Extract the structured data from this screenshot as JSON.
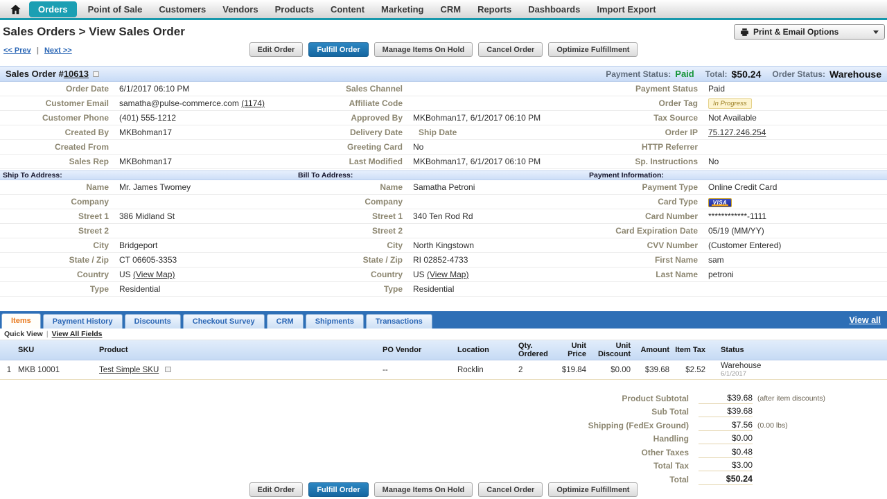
{
  "nav": {
    "items": [
      "Orders",
      "Point of Sale",
      "Customers",
      "Vendors",
      "Products",
      "Content",
      "Marketing",
      "CRM",
      "Reports",
      "Dashboards",
      "Import Export"
    ]
  },
  "header": {
    "title": "Sales Orders > View Sales Order",
    "print_email": "Print & Email Options"
  },
  "pager": {
    "prev": "<< Prev",
    "sep": "|",
    "next": "Next >>"
  },
  "buttons": {
    "edit": "Edit Order",
    "fulfill": "Fulfill Order",
    "manage_hold": "Manage Items On Hold",
    "cancel": "Cancel Order",
    "optimize": "Optimize Fulfillment"
  },
  "order_bar": {
    "title": "Sales Order #",
    "number": "10613",
    "payment_status_label": "Payment Status:",
    "payment_status": "Paid",
    "total_label": "Total:",
    "total": "$50.24",
    "order_status_label": "Order Status:",
    "order_status": "Warehouse"
  },
  "details": {
    "rows": [
      {
        "c1l": "Order Date",
        "c1v": "6/1/2017 06:10 PM",
        "c2l": "Sales Channel",
        "c2v": "",
        "c3l": "Payment Status",
        "c3v": "Paid"
      },
      {
        "c1l": "Customer Email",
        "c1v": "samatha@pulse-commerce.com",
        "c1link": "(1174)",
        "c2l": "Affiliate Code",
        "c2v": "",
        "c3l": "Order Tag",
        "c3badge": "In Progress"
      },
      {
        "c1l": "Customer Phone",
        "c1v": "(401) 555-1212",
        "c2l": "Approved By",
        "c2v": "MKBohman17, 6/1/2017 06:10 PM",
        "c3l": "Tax Source",
        "c3v": "Not Available"
      },
      {
        "c1l": "Created By",
        "c1v": "MKBohman17",
        "c2l": "Delivery Date",
        "c2sublabel": "Ship Date",
        "c3l": "Order IP",
        "c3link": "75.127.246.254"
      },
      {
        "c1l": "Created From",
        "c1v": "",
        "c2l": "Greeting Card",
        "c2v": "No",
        "c3l": "HTTP Referrer",
        "c3v": ""
      },
      {
        "c1l": "Sales Rep",
        "c1v": "MKBohman17",
        "c2l": "Last Modified",
        "c2v": "MKBohman17, 6/1/2017 06:10 PM",
        "c3l": "Sp. Instructions",
        "c3v": "No"
      }
    ]
  },
  "sections": {
    "ship_to": "Ship To Address:",
    "bill_to": "Bill To Address:",
    "payment_info": "Payment Information:"
  },
  "address": {
    "rows": [
      {
        "c1l": "Name",
        "c1v": "Mr. James Twomey",
        "c2l": "Name",
        "c2v": "Samatha Petroni",
        "c3l": "Payment Type",
        "c3v": "Online Credit Card"
      },
      {
        "c1l": "Company",
        "c1v": "",
        "c2l": "Company",
        "c2v": "",
        "c3l": "Card Type",
        "c3visa": "VISA"
      },
      {
        "c1l": "Street 1",
        "c1v": "386 Midland St",
        "c2l": "Street 1",
        "c2v": "340 Ten Rod Rd",
        "c3l": "Card Number",
        "c3v": "************-1111"
      },
      {
        "c1l": "Street 2",
        "c1v": "",
        "c2l": "Street 2",
        "c2v": "",
        "c3l": "Card Expiration Date",
        "c3v": "05/19 (MM/YY)"
      },
      {
        "c1l": "City",
        "c1v": "Bridgeport",
        "c2l": "City",
        "c2v": "North Kingstown",
        "c3l": "CVV Number",
        "c3v": "(Customer Entered)"
      },
      {
        "c1l": "State / Zip",
        "c1v": "CT 06605-3353",
        "c2l": "State / Zip",
        "c2v": "RI 02852-4733",
        "c3l": "First Name",
        "c3v": "sam"
      },
      {
        "c1l": "Country",
        "c1v": "US",
        "c1link": "(View Map)",
        "c2l": "Country",
        "c2v": "US",
        "c2link": "(View Map)",
        "c3l": "Last Name",
        "c3v": "petroni"
      },
      {
        "c1l": "Type",
        "c1v": "Residential",
        "c2l": "Type",
        "c2v": "Residential",
        "c3l": "",
        "c3v": ""
      }
    ]
  },
  "tabs": {
    "items": "Items",
    "payment_history": "Payment History",
    "discounts": "Discounts",
    "checkout_survey": "Checkout Survey",
    "crm": "CRM",
    "shipments": "Shipments",
    "transactions": "Transactions",
    "view_all": "View all"
  },
  "quickview": {
    "quick_view": "Quick View",
    "sep": "|",
    "view_all_fields": "View All Fields"
  },
  "items_table": {
    "headers": {
      "sku": "SKU",
      "product": "Product",
      "po_vendor": "PO Vendor",
      "location": "Location",
      "qty": "Qty. Ordered",
      "unit_price": "Unit Price",
      "unit_discount": "Unit Discount",
      "amount": "Amount",
      "item_tax": "Item Tax",
      "status": "Status"
    },
    "row": {
      "num": "1",
      "sku": "MKB 10001",
      "product": "Test Simple SKU",
      "po_vendor": "--",
      "location": "Rocklin",
      "qty": "2",
      "unit_price": "$19.84",
      "unit_discount": "$0.00",
      "amount": "$39.68",
      "item_tax": "$2.52",
      "status": "Warehouse",
      "status_date": "6/1/2017"
    }
  },
  "totals": {
    "rows": [
      {
        "label": "Product Subtotal",
        "value": "$39.68",
        "note": "(after item discounts)"
      },
      {
        "label": "Sub Total",
        "value": "$39.68",
        "note": ""
      },
      {
        "label": "Shipping (FedEx Ground)",
        "value": "$7.56",
        "note": "(0.00 lbs)"
      },
      {
        "label": "Handling",
        "value": "$0.00",
        "note": ""
      },
      {
        "label": "Other Taxes",
        "value": "$0.48",
        "note": ""
      },
      {
        "label": "Total Tax",
        "value": "$3.00",
        "note": ""
      },
      {
        "label": "Total",
        "value": "$50.24",
        "note": ""
      }
    ]
  }
}
